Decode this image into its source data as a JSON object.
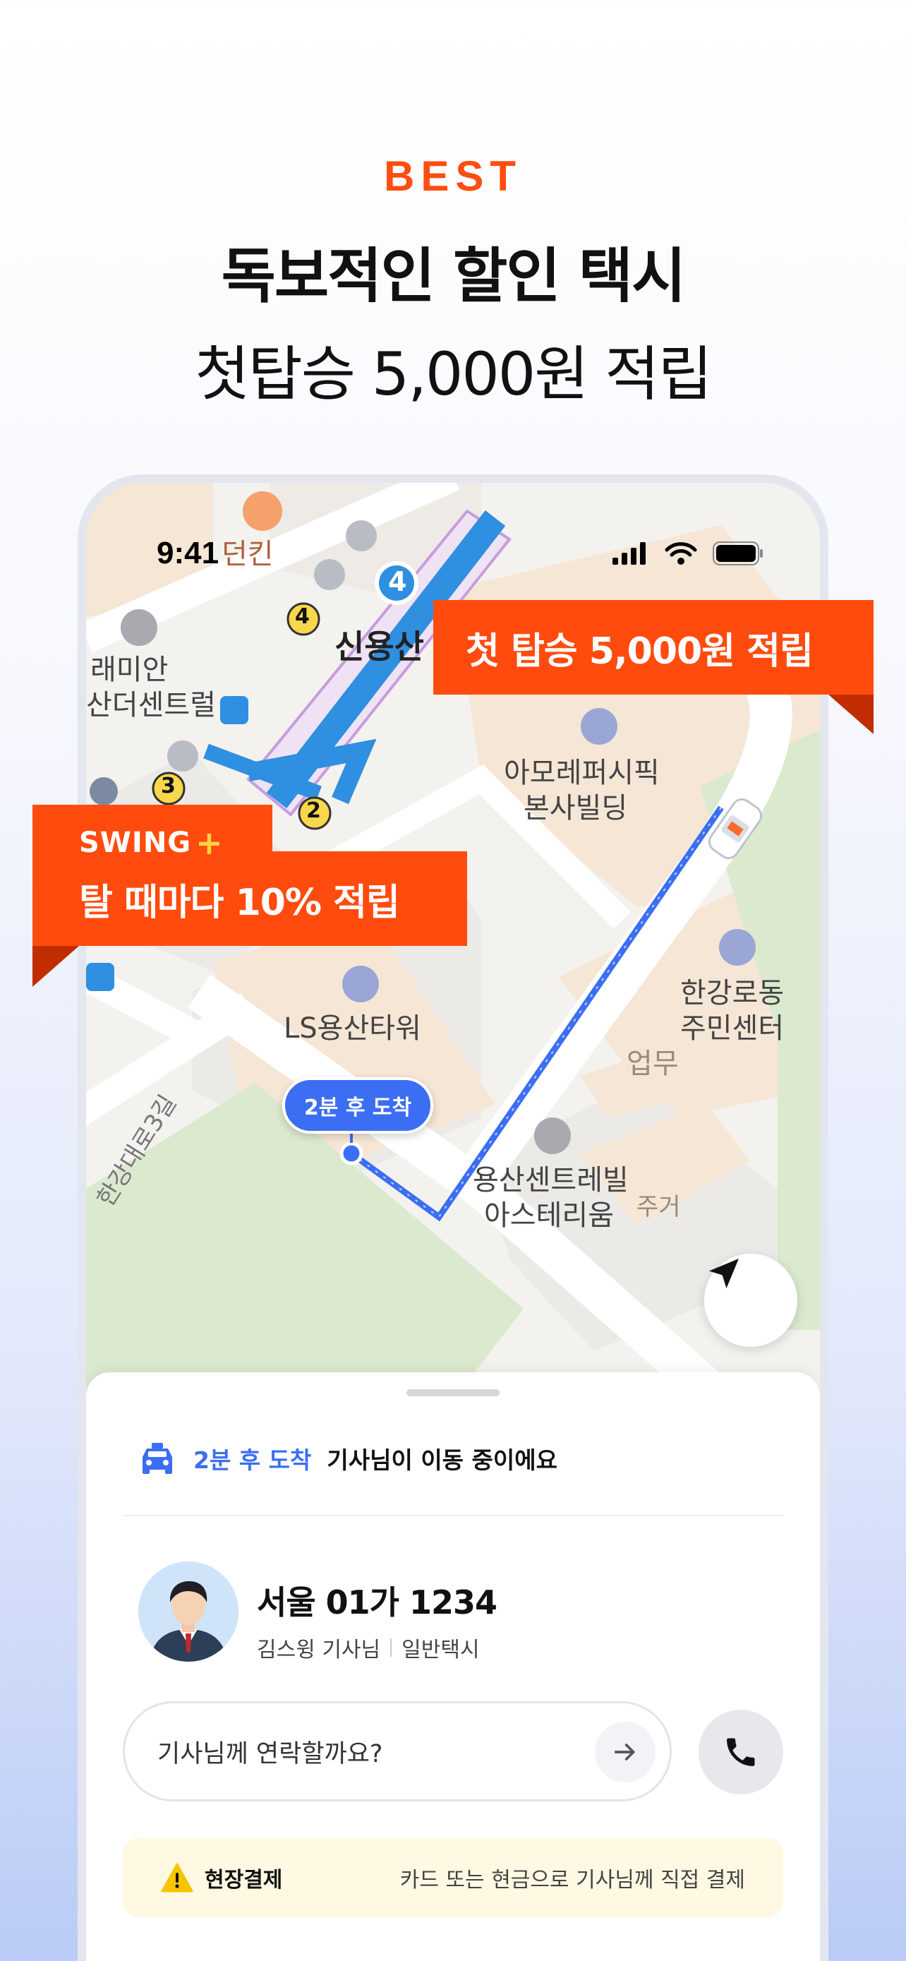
{
  "header": {
    "badge": "BEST",
    "title": "독보적인 할인 택시",
    "subtitle": "첫탑승 5,000원 적립"
  },
  "status_bar": {
    "time": "9:41"
  },
  "map": {
    "labels": {
      "shop": "던킨",
      "station": "신용산",
      "apartment": "래미안",
      "apartment_2": "산더센트럴",
      "amore_1": "아모레퍼시픽",
      "amore_2": "본사빌딩",
      "ls_tower": "LS용산타워",
      "hangang_1": "한강로동",
      "hangang_2": "주민센터",
      "office": "업무",
      "residence_1": "용산센트레빌",
      "residence_2": "아스테리움",
      "residence_tag": "주거",
      "road": "한강대로3길",
      "line_number": "4",
      "exit_2": "2",
      "exit_3": "3",
      "exit_4": "4"
    },
    "eta_bubble": "2분 후 도착"
  },
  "banners": {
    "first_ride": "첫 탑승 5,000원 적립",
    "swing_brand": "SWING",
    "swing_plus": "+",
    "swing_reward": "탈 때마다 10% 적립"
  },
  "sheet": {
    "eta": "2분 후 도착",
    "status_message": "기사님이 이동 중이에요",
    "plate": "서울 01가 1234",
    "driver_name": "김스윙 기사님",
    "taxi_type": "일반택시",
    "message_placeholder": "기사님께 연락할까요?",
    "payment_title": "현장결제",
    "payment_desc": "카드 또는 현금으로 기사님께 직접 결제"
  },
  "colors": {
    "accent": "#ff4c0e",
    "brand_blue": "#3b6ef3",
    "subway_blue": "#2f8fe0"
  },
  "icons": {
    "taxi": "taxi-icon",
    "send": "arrow-right-icon",
    "call": "phone-icon",
    "warning": "warning-icon",
    "locate": "navigation-arrow-icon"
  }
}
